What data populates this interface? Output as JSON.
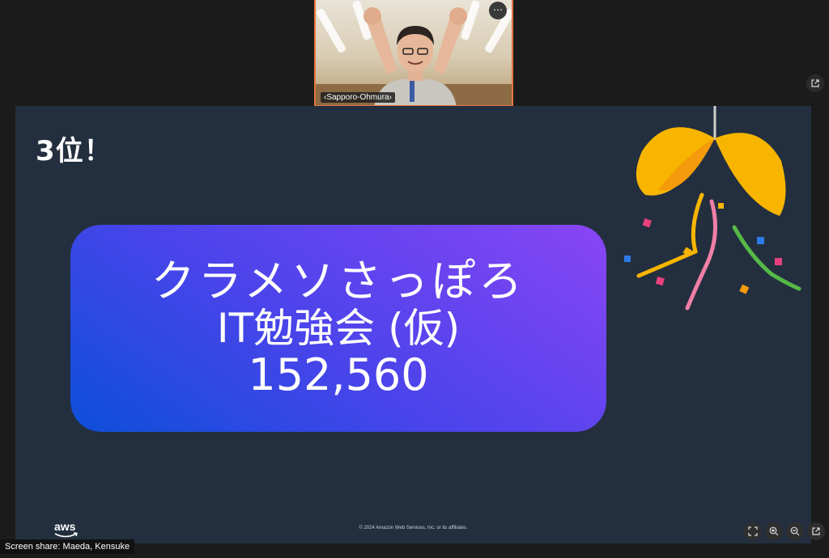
{
  "participant": {
    "name": "‹Sapporo-Ohmura›",
    "more_icon": "more-horizontal-icon",
    "border_color": "#e8753e"
  },
  "slide": {
    "heading": "3位！",
    "card": {
      "line1": "クラメソさっぽろ",
      "line2": "IT勉強会 (仮)",
      "line3": "152,560"
    },
    "logo_text": "aws",
    "copyright": "© 2024 Amazon Web Services, Inc. or its affiliates.",
    "background_color": "#232f3e",
    "decoration": "kusudama-confetti"
  },
  "controls": {
    "fullscreen_icon": "fullscreen-icon",
    "zoom_in_icon": "zoom-in-icon",
    "zoom_out_icon": "zoom-out-icon",
    "popout_icon": "popout-icon"
  },
  "share_label": "Screen share: Maeda, Kensuke"
}
